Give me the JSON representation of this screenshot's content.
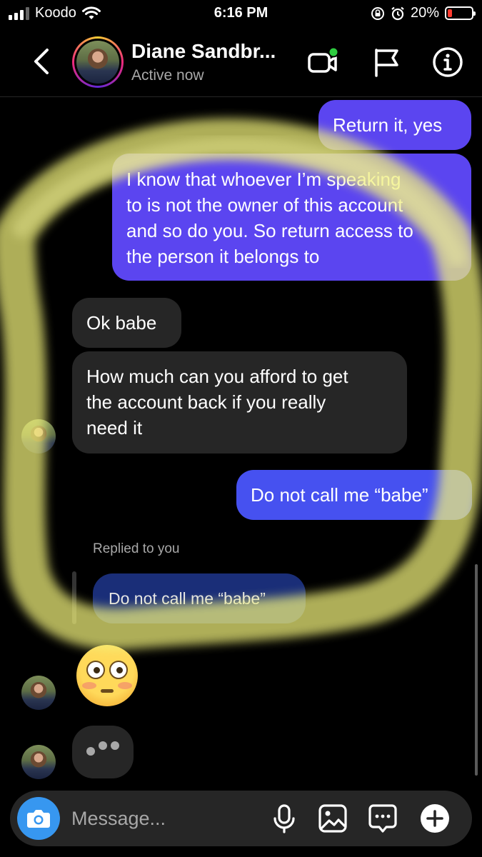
{
  "status_bar": {
    "carrier": "Koodo",
    "time": "6:16 PM",
    "battery_percent": "20%",
    "battery_level": 0.2,
    "icons": [
      "signal-icon",
      "wifi-icon",
      "orientation-lock-icon",
      "alarm-icon",
      "battery-icon"
    ]
  },
  "header": {
    "contact_name": "Diane Sandbr...",
    "contact_status": "Active now",
    "icons": [
      "back-icon",
      "video-call-icon",
      "flag-icon",
      "info-icon"
    ],
    "online_color": "#2ecc40"
  },
  "messages": {
    "out_1": "Return it, yes",
    "out_2_lines": [
      "I know that whoever I’m speaking",
      "to is not the owner of this account",
      "and so do you. So return access to",
      "the person it belongs to"
    ],
    "in_1": "Ok babe",
    "in_2_lines": [
      "How much can you afford to get",
      "the account back if you really",
      "need it"
    ],
    "out_3": "Do not call me “babe”",
    "replied_label": "Replied to you",
    "reply_quote": "Do not call me “babe”",
    "emoji_name": "flushed-face-emoji"
  },
  "composer": {
    "placeholder": "Message...",
    "icons": [
      "camera-icon",
      "microphone-icon",
      "gallery-icon",
      "sticker-icon",
      "add-icon"
    ]
  },
  "colors": {
    "outgoing_purple": "#5b45f0",
    "outgoing_blue": "#4651f0",
    "incoming": "#262626",
    "camera_button": "#3797f0",
    "highlighter": "#f2f27a"
  }
}
